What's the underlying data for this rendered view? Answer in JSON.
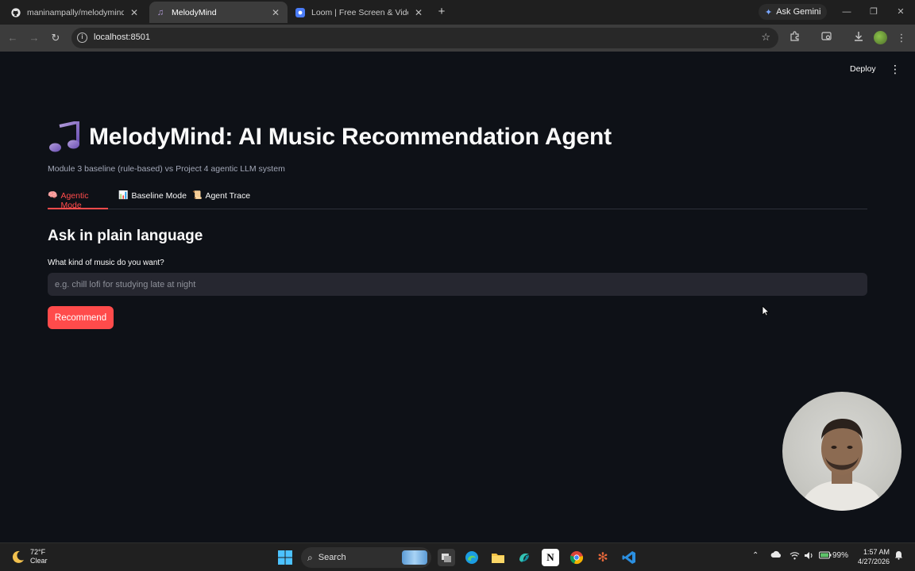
{
  "browser": {
    "tabs": [
      {
        "title": "maninampally/melodymind-ai-"
      },
      {
        "title": "MelodyMind"
      },
      {
        "title": "Loom | Free Screen & Video Re"
      }
    ],
    "ask_gemini": "Ask Gemini",
    "url": "localhost:8501"
  },
  "app": {
    "deploy_label": "Deploy",
    "title": "MelodyMind: AI Music Recommendation Agent",
    "subtitle": "Module 3 baseline (rule-based) vs Project 4 agentic LLM system",
    "tabs": [
      {
        "emoji": "🧠",
        "label": "Agentic Mode"
      },
      {
        "emoji": "📊",
        "label": "Baseline Mode"
      },
      {
        "emoji": "📜",
        "label": "Agent Trace"
      }
    ],
    "section_heading": "Ask in plain language",
    "input_label": "What kind of music do you want?",
    "input_placeholder": "e.g. chill lofi for studying late at night",
    "input_value": "",
    "button_label": "Recommend"
  },
  "taskbar": {
    "weather_temp": "72°F",
    "weather_cond": "Clear",
    "search_label": "Search",
    "battery": "99%",
    "time": "1:57 AM",
    "date": "4/27/2026"
  },
  "colors": {
    "accent": "#ff4b4b",
    "background": "#0e1117",
    "input_bg": "#262730"
  }
}
